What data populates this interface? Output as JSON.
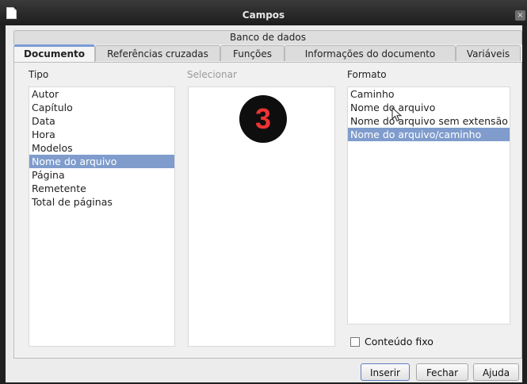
{
  "window": {
    "title": "Campos",
    "close_symbol": "×"
  },
  "tabs": {
    "top": "Banco de dados",
    "items": [
      {
        "label": "Documento",
        "active": true
      },
      {
        "label": "Referências cruzadas",
        "active": false
      },
      {
        "label": "Funções",
        "active": false
      },
      {
        "label": "Informações do documento",
        "active": false
      },
      {
        "label": "Variáveis",
        "active": false
      }
    ]
  },
  "columns": {
    "tipo": "Tipo",
    "selecionar": "Selecionar",
    "formato": "Formato"
  },
  "tipo_list": [
    "Autor",
    "Capítulo",
    "Data",
    "Hora",
    "Modelos",
    "Nome do arquivo",
    "Página",
    "Remetente",
    "Total de páginas"
  ],
  "tipo_selected": "Nome do arquivo",
  "formato_list": [
    "Caminho",
    "Nome do arquivo",
    "Nome do arquivo sem extensão",
    "Nome do arquivo/caminho"
  ],
  "formato_selected": "Nome do arquivo/caminho",
  "step_badge": "3",
  "checkbox": {
    "label": "Conteúdo fixo",
    "checked": false
  },
  "buttons": {
    "insert": "Inserir",
    "close": "Fechar",
    "help": "Ajuda"
  },
  "colors": {
    "selection": "#7f9ccc",
    "badge_text": "#e33333"
  }
}
